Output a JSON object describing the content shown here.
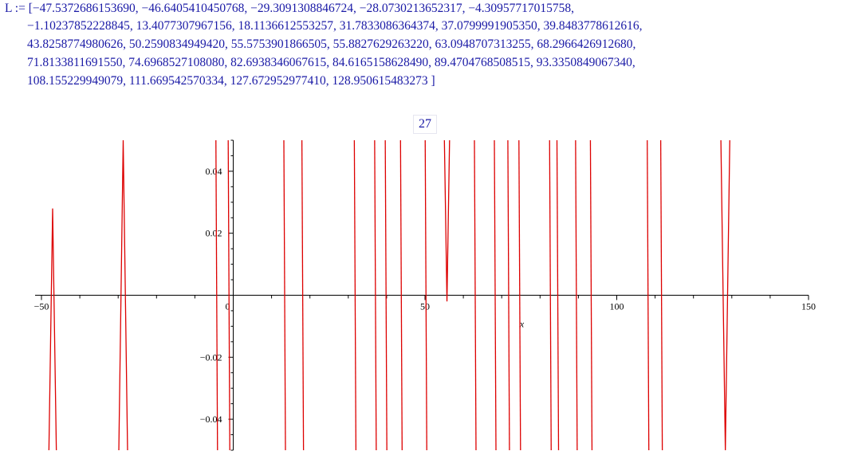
{
  "output": {
    "line1": "L := [−47.5372686153690, −46.6405410450768, −29.3091308846724, −28.0730213652317, −4.30957717015758,",
    "line2": "−1.10237852228845, 13.4077307967156, 18.1136612553257, 31.7833086364374, 37.0799991905350, 39.8483778612616,",
    "line3": "43.8258774980626, 50.2590834949420, 55.5753901866505, 55.8827629263220, 63.0948707313255, 68.2966426912680,",
    "line4": "71.8133811691550, 74.6968527108080, 82.6938346067615, 84.6165158628490, 89.4704768508515, 93.3350849067340,",
    "line5": "108.155229949079, 111.669542570334, 127.672952977410, 128.950615483273 ]",
    "count": "27"
  },
  "chart_data": {
    "type": "line",
    "title": "",
    "xlabel": "x",
    "ylabel": "",
    "xlim": [
      -50,
      150
    ],
    "ylim": [
      -0.05,
      0.05
    ],
    "xticks": [
      -50,
      0,
      50,
      100,
      150
    ],
    "xtick_labels": [
      "−50",
      "0",
      "50",
      "100",
      "150"
    ],
    "yticks": [
      -0.04,
      -0.02,
      0.02,
      0.04
    ],
    "ytick_labels": [
      "−0.04",
      "−0.02",
      "0.02",
      "0.04"
    ],
    "grid": false,
    "line_color": "#dd0000",
    "roots": [
      -47.537268615369,
      -46.6405410450768,
      -29.3091308846724,
      -28.0730213652317,
      -4.30957717015758,
      -1.10237852228845,
      13.4077307967156,
      18.1136612553257,
      31.7833086364374,
      37.079999190535,
      39.8483778612616,
      43.8258774980626,
      50.259083494942,
      55.5753901866505,
      55.882762926322,
      63.0948707313255,
      68.296642691268,
      71.813381169155,
      74.696852710808,
      82.6938346067615,
      84.616515862849,
      89.4704768508515,
      93.335084906734,
      108.155229949079,
      111.669542570334,
      127.67295297741,
      128.950615483273
    ],
    "peaks": [
      {
        "between": [
          -47.537268615369,
          -46.6405410450768
        ],
        "y": 0.028
      },
      {
        "between": [
          -29.3091308846724,
          -28.0730213652317
        ],
        "y": 0.05
      },
      {
        "between": [
          55.5753901866505,
          55.882762926322
        ],
        "y": -0.002
      },
      {
        "between": [
          127.67295297741,
          128.950615483273
        ],
        "y": -0.05
      }
    ]
  }
}
